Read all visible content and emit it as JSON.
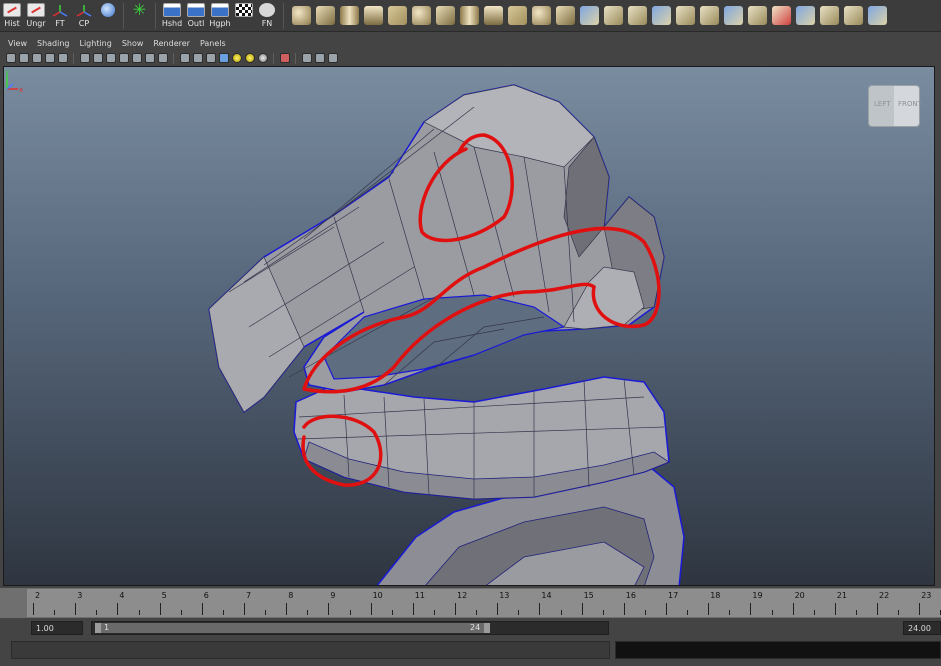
{
  "shelf": {
    "labeled_tools": [
      {
        "label": "Hist",
        "icon": "history-doc-icon"
      },
      {
        "label": "Ungr",
        "icon": "ungroup-doc-icon"
      },
      {
        "label": "FT",
        "icon": "freeze-transforms-axis-icon"
      },
      {
        "label": "CP",
        "icon": "center-pivot-axis-icon"
      },
      {
        "label": "",
        "icon": "globe-tool-icon"
      },
      {
        "label": "",
        "icon": "star-tool-icon"
      },
      {
        "label": "Hshd",
        "icon": "hypershade-icon"
      },
      {
        "label": "Outl",
        "icon": "outliner-icon"
      },
      {
        "label": "Hgph",
        "icon": "hypergraph-icon"
      },
      {
        "label": "",
        "icon": "uv-checker-icon"
      },
      {
        "label": "FN",
        "icon": "fn-eye-icon"
      }
    ],
    "primitive_icons": [
      "sphere-icon",
      "cube-icon",
      "cylinder-icon",
      "cone-icon",
      "plane-icon",
      "torus-icon",
      "prism-icon",
      "pyramid-icon",
      "pipe-icon",
      "helix-icon",
      "soccer-ball-icon",
      "platonic-icon",
      "poly-combine-icon",
      "poly-separate-icon",
      "poly-extract-icon",
      "poly-boolean-icon",
      "poly-smooth-icon",
      "poly-reduce-icon",
      "mirror-geometry-icon",
      "extrude-icon",
      "bridge-icon",
      "append-polygon-icon",
      "fill-hole-icon",
      "split-polygon-icon",
      "bevel-icon"
    ]
  },
  "panel_menu": {
    "items": [
      "View",
      "Shading",
      "Lighting",
      "Show",
      "Renderer",
      "Panels"
    ]
  },
  "panel_toolbar": {
    "icons": [
      "select-camera-icon",
      "camera-attributes-icon",
      "bookmark-icon",
      "image-plane-icon",
      "2d-pan-zoom-icon",
      "grid-icon",
      "film-gate-icon",
      "resolution-gate-icon",
      "gate-mask-icon",
      "field-chart-icon",
      "safe-action-icon",
      "safe-title-icon",
      "wireframe-icon",
      "smooth-shade-icon",
      "wireframe-on-shaded-icon",
      "textured-icon",
      "use-all-lights-icon",
      "shadows-icon",
      "ambient-occlusion-icon",
      "isolate-select-icon",
      "xray-icon",
      "xray-joints-icon",
      "xray-components-icon"
    ]
  },
  "viewport": {
    "view_cube": {
      "left": "LEFT",
      "front": "FRONT"
    },
    "axis": {
      "y": "y",
      "x": "x"
    }
  },
  "time_slider": {
    "ticks": [
      "2",
      "3",
      "4",
      "5",
      "6",
      "7",
      "8",
      "9",
      "10",
      "11",
      "12",
      "13",
      "14",
      "15",
      "16",
      "17",
      "18",
      "19",
      "20",
      "21",
      "22",
      "23"
    ],
    "current_frame": "24"
  },
  "range_slider": {
    "start_time": "1.00",
    "playback_start": "1",
    "playback_end": "24",
    "end_time": "24.00"
  },
  "command_line": {
    "value": ""
  },
  "colors": {
    "viewport_top": "#7a8ca0",
    "viewport_bottom": "#2e3540",
    "mesh_fill": "#8f9096",
    "wire_blue": "#1a1ad6",
    "annotation_red": "#e01010"
  }
}
